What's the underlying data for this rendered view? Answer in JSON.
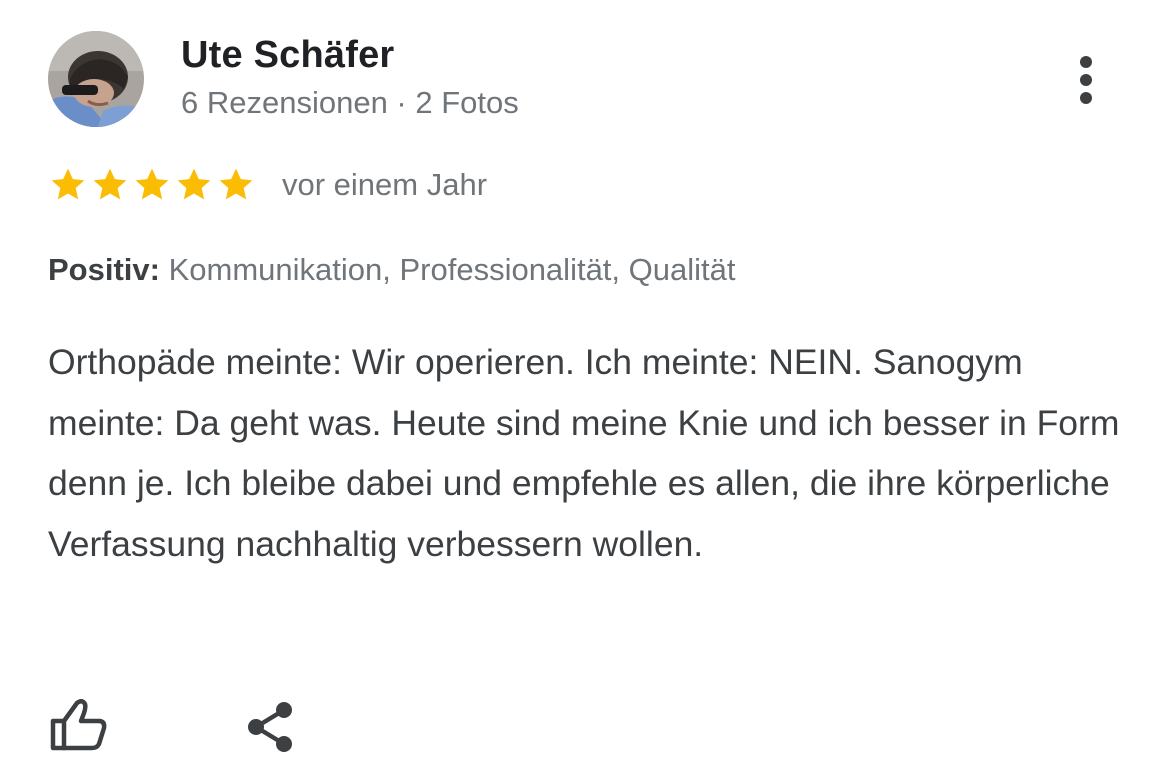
{
  "reviewer": {
    "name": "Ute Schäfer",
    "meta": "6 Rezensionen · 2 Fotos",
    "avatar_icon": "avatar-photo"
  },
  "rating": {
    "stars": 5,
    "max": 5,
    "star_color": "#fbbc04",
    "date": "vor einem Jahr"
  },
  "attributes": {
    "label": "Positiv:",
    "value": "Kommunikation, Professionalität, Qualität"
  },
  "review": {
    "text": "Orthopäde meinte: Wir operieren. Ich meinte: NEIN. Sanogym meinte: Da geht was. Heute sind meine Knie und ich besser in Form denn je. Ich bleibe dabei und empfehle es allen, die ihre körperliche Verfassung nachhaltig verbessern wollen."
  },
  "actions": {
    "more_icon": "more-vert-icon",
    "like_icon": "thumb-up-icon",
    "share_icon": "share-icon"
  },
  "colors": {
    "text_primary": "#202124",
    "text_body": "#3c4043",
    "text_secondary": "#70757a",
    "icon": "#3c4043"
  }
}
